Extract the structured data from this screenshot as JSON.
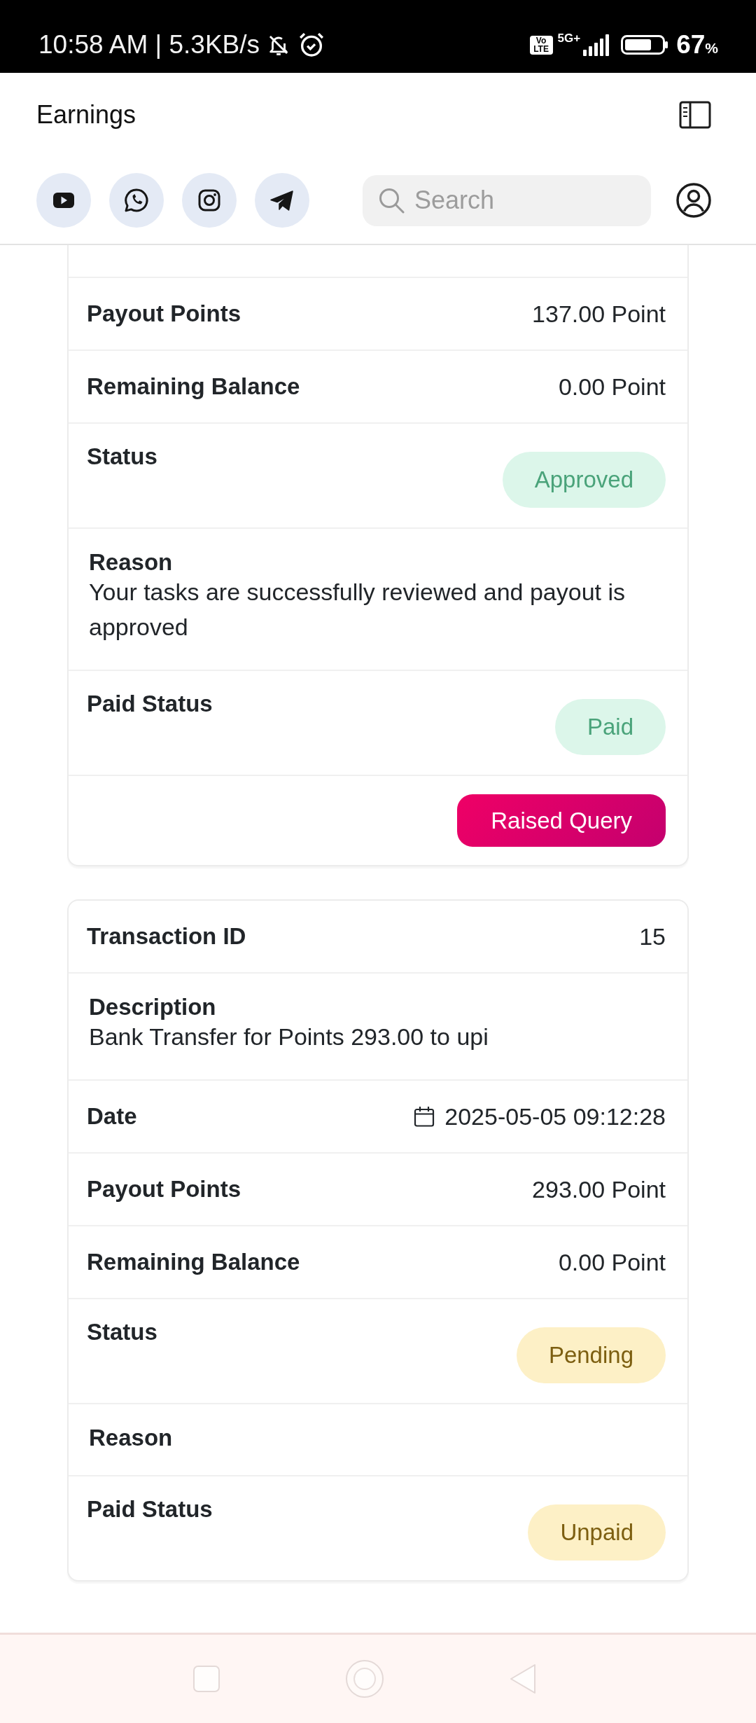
{
  "status_bar": {
    "time_speed": "10:58 AM | 5.3KB/s",
    "volte": "Vo LTE",
    "network_type": "5G+",
    "battery": "67",
    "battery_unit": "%"
  },
  "header": {
    "title": "Earnings"
  },
  "social_links": [
    {
      "kind": "video"
    },
    {
      "kind": "chat"
    },
    {
      "kind": "camera"
    },
    {
      "kind": "send"
    }
  ],
  "search": {
    "placeholder": "Search"
  },
  "cards": [
    {
      "cut_off_top": true,
      "rows": [
        {
          "kind": "value",
          "label": "Payout Points",
          "value": "137.00 Point"
        },
        {
          "kind": "value",
          "label": "Remaining Balance",
          "value": "0.00 Point"
        },
        {
          "kind": "badge",
          "label": "Status",
          "badge": "Approved",
          "positive": true
        },
        {
          "kind": "text",
          "label": "Reason",
          "text": "Your tasks are successfully reviewed and payout is approved"
        },
        {
          "kind": "badge",
          "label": "Paid Status",
          "badge": "Paid",
          "positive": true
        },
        {
          "kind": "action",
          "button": "Raised Query"
        }
      ]
    },
    {
      "cut_off_top": false,
      "rows": [
        {
          "kind": "value",
          "label": "Transaction ID",
          "value": "15"
        },
        {
          "kind": "text",
          "label": "Description",
          "text": "Bank Transfer for Points 293.00 to upi"
        },
        {
          "kind": "date",
          "label": "Date",
          "value": "2025-05-05 09:12:28"
        },
        {
          "kind": "value",
          "label": "Payout Points",
          "value": "293.00 Point"
        },
        {
          "kind": "value",
          "label": "Remaining Balance",
          "value": "0.00 Point"
        },
        {
          "kind": "badge",
          "label": "Status",
          "badge": "Pending",
          "positive": false
        },
        {
          "kind": "text",
          "label": "Reason"
        },
        {
          "kind": "badge",
          "label": "Paid Status",
          "badge": "Unpaid",
          "positive": false
        }
      ]
    }
  ],
  "nav_bar": {
    "buttons": [
      {
        "kind": "recents"
      },
      {
        "kind": "home"
      },
      {
        "kind": "back"
      }
    ]
  }
}
